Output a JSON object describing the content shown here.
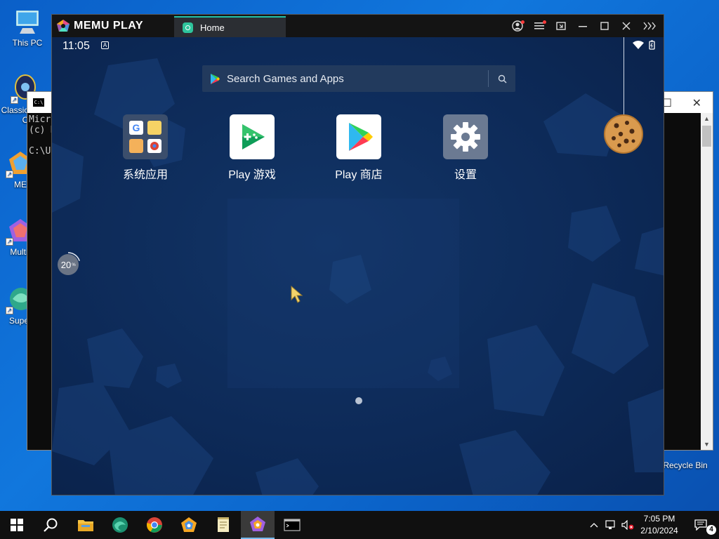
{
  "desktop": {
    "icons": [
      {
        "label": "This PC"
      },
      {
        "label": "Classic Shell C"
      },
      {
        "label": "ME"
      },
      {
        "label": "Multi-"
      },
      {
        "label": "Super"
      },
      {
        "label": "Recycle Bin"
      }
    ]
  },
  "console": {
    "line1": "Micro",
    "line2": "(c) M",
    "line3": "C:\\U"
  },
  "memu": {
    "logo": "MEMU PLAY",
    "tab_home": "Home",
    "status": {
      "time": "11:05",
      "keyboard_badge": "A"
    },
    "search": {
      "placeholder": "Search Games and Apps"
    },
    "apps": [
      {
        "label": "系统应用",
        "icon": "system-apps-folder-icon"
      },
      {
        "label": "Play 游戏",
        "icon": "play-games-icon"
      },
      {
        "label": "Play 商店",
        "icon": "play-store-icon"
      },
      {
        "label": "设置",
        "icon": "settings-gear-icon"
      }
    ],
    "progress_text": "20",
    "progress_unit": "%",
    "progress_value": 20
  },
  "taskbar": {
    "time": "7:05 PM",
    "date": "2/10/2024",
    "notifications": "4"
  }
}
